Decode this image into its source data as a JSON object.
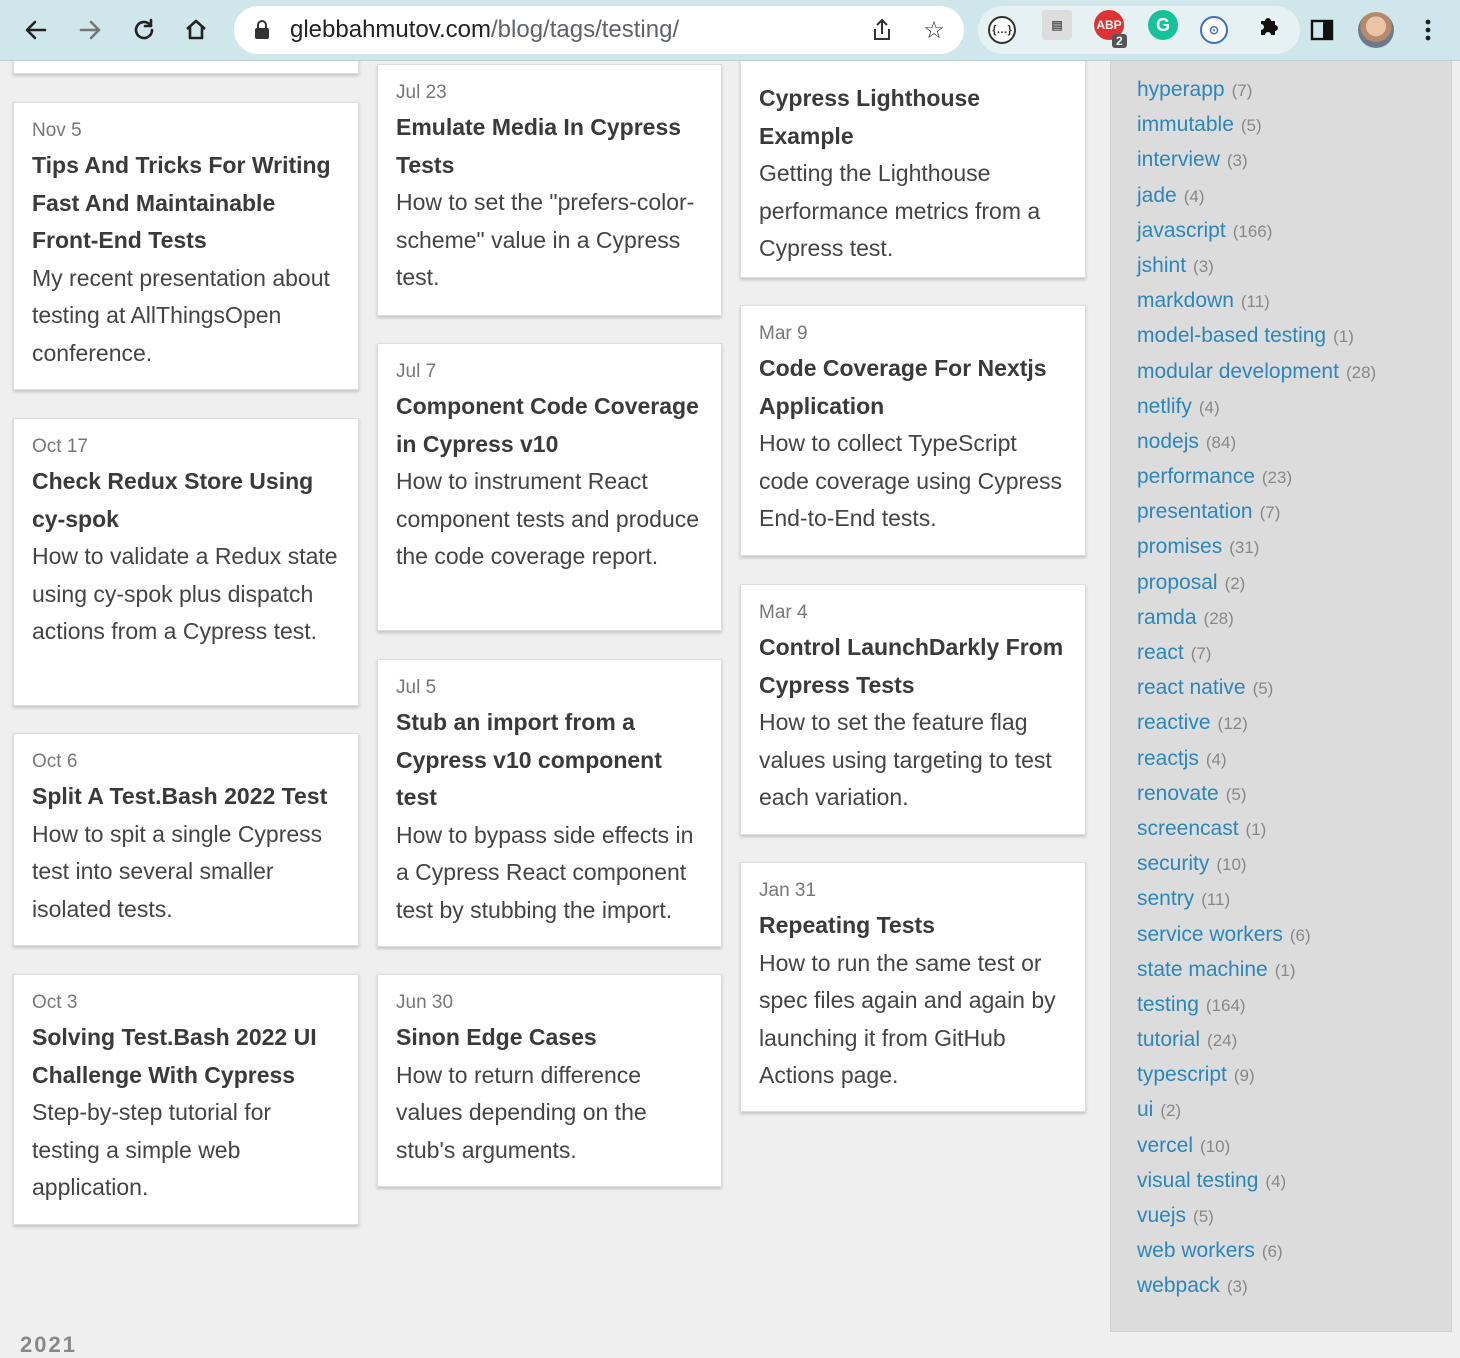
{
  "browser": {
    "url_domain": "glebbahmutov.com",
    "url_path": "/blog/tags/testing/"
  },
  "extensions": {
    "abp_label": "ABP",
    "abp_badge": "2"
  },
  "posts": [
    {
      "date": "Nov 5",
      "title": "Tips And Tricks For Writing Fast And Maintainable Front-End Tests",
      "desc": "My recent presentation about testing at AllThingsOpen conference."
    },
    {
      "date": "Oct 17",
      "title": "Check Redux Store Using cy-spok",
      "desc": "How to validate a Redux state using cy-spok plus dispatch actions from a Cypress test."
    },
    {
      "date": "Oct 6",
      "title": "Split A Test.Bash 2022 Test",
      "desc": "How to spit a single Cypress test into several smaller isolated tests."
    },
    {
      "date": "Oct 3",
      "title": "Solving Test.Bash 2022 UI Challenge With Cypress",
      "desc": "Step-by-step tutorial for testing a simple web application."
    },
    {
      "date": "Jul 23",
      "title": "Emulate Media In Cypress Tests",
      "desc": "How to set the \"prefers-color-scheme\" value in a Cypress test."
    },
    {
      "date": "Jul 7",
      "title": "Component Code Coverage in Cypress v10",
      "desc": "How to instrument React component tests and produce the code coverage report."
    },
    {
      "date": "Jul 5",
      "title": "Stub an import from a Cypress v10 component test",
      "desc": "How to bypass side effects in a Cypress React component test by stubbing the import."
    },
    {
      "date": "Jun 30",
      "title": "Sinon Edge Cases",
      "desc": "How to return difference values depending on the stub's arguments."
    },
    {
      "date": "",
      "title": "Cypress Lighthouse Example",
      "desc": "Getting the Lighthouse performance metrics from a Cypress test."
    },
    {
      "date": "Mar 9",
      "title": "Code Coverage For Nextjs Application",
      "desc": "How to collect TypeScript code coverage using Cypress End-to-End tests."
    },
    {
      "date": "Mar 4",
      "title": "Control LaunchDarkly From Cypress Tests",
      "desc": "How to set the feature flag values using targeting to test each variation."
    },
    {
      "date": "Jan 31",
      "title": "Repeating Tests",
      "desc": "How to run the same test or spec files again and again by launching it from GitHub Actions page."
    }
  ],
  "tags": [
    {
      "name": "hyperapp",
      "count": "(7)"
    },
    {
      "name": "immutable",
      "count": "(5)"
    },
    {
      "name": "interview",
      "count": "(3)"
    },
    {
      "name": "jade",
      "count": "(4)"
    },
    {
      "name": "javascript",
      "count": "(166)"
    },
    {
      "name": "jshint",
      "count": "(3)"
    },
    {
      "name": "markdown",
      "count": "(11)"
    },
    {
      "name": "model-based testing",
      "count": "(1)"
    },
    {
      "name": "modular development",
      "count": "(28)"
    },
    {
      "name": "netlify",
      "count": "(4)"
    },
    {
      "name": "nodejs",
      "count": "(84)"
    },
    {
      "name": "performance",
      "count": "(23)"
    },
    {
      "name": "presentation",
      "count": "(7)"
    },
    {
      "name": "promises",
      "count": "(31)"
    },
    {
      "name": "proposal",
      "count": "(2)"
    },
    {
      "name": "ramda",
      "count": "(28)"
    },
    {
      "name": "react",
      "count": "(7)"
    },
    {
      "name": "react native",
      "count": "(5)"
    },
    {
      "name": "reactive",
      "count": "(12)"
    },
    {
      "name": "reactjs",
      "count": "(4)"
    },
    {
      "name": "renovate",
      "count": "(5)"
    },
    {
      "name": "screencast",
      "count": "(1)"
    },
    {
      "name": "security",
      "count": "(10)"
    },
    {
      "name": "sentry",
      "count": "(11)"
    },
    {
      "name": "service workers",
      "count": "(6)"
    },
    {
      "name": "state machine",
      "count": "(1)"
    },
    {
      "name": "testing",
      "count": "(164)"
    },
    {
      "name": "tutorial",
      "count": "(24)"
    },
    {
      "name": "typescript",
      "count": "(9)"
    },
    {
      "name": "ui",
      "count": "(2)"
    },
    {
      "name": "vercel",
      "count": "(10)"
    },
    {
      "name": "visual testing",
      "count": "(4)"
    },
    {
      "name": "vuejs",
      "count": "(5)"
    },
    {
      "name": "web workers",
      "count": "(6)"
    },
    {
      "name": "webpack",
      "count": "(3)"
    }
  ],
  "year_heading": "2021",
  "colors": {
    "link": "#2a87b8",
    "toolbar": "#cfe6ea"
  }
}
